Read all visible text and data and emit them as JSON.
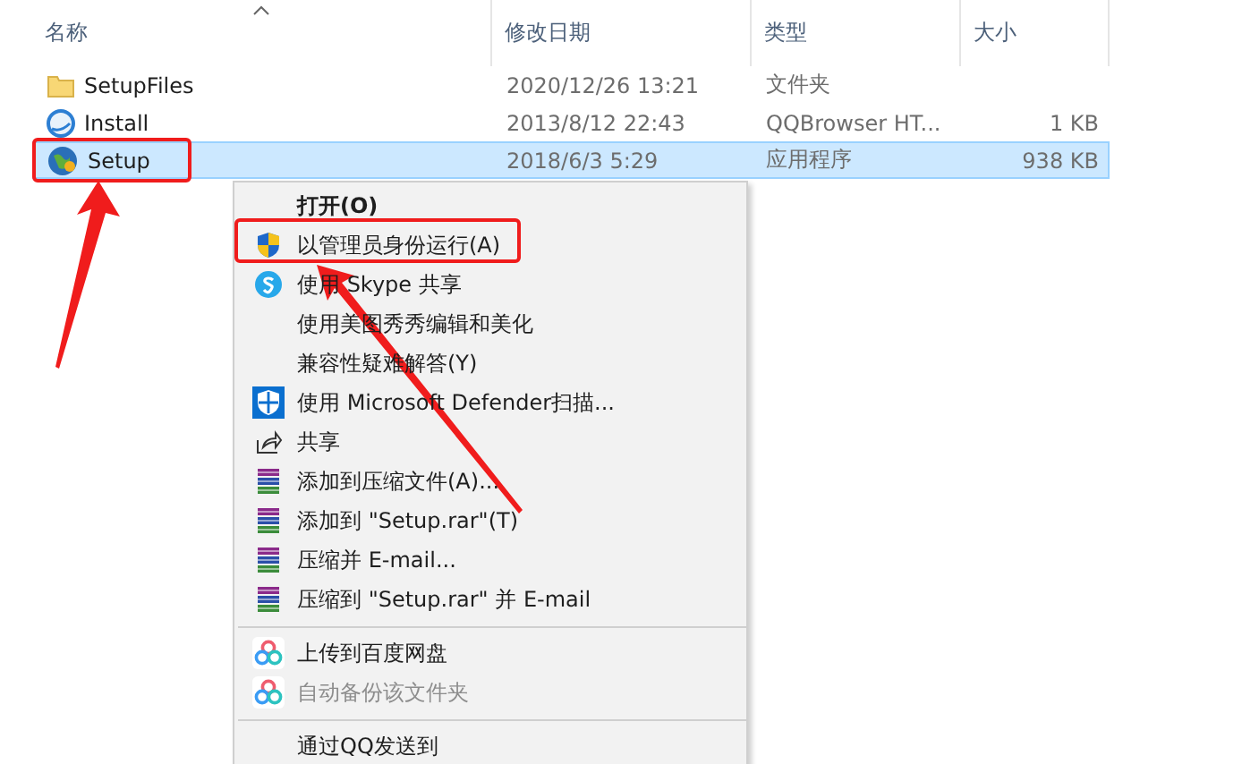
{
  "columns": [
    {
      "label": "名称",
      "sorted": true
    },
    {
      "label": "修改日期",
      "sorted": false
    },
    {
      "label": "类型",
      "sorted": false
    },
    {
      "label": "大小",
      "sorted": false
    }
  ],
  "files": [
    {
      "kind": "folder",
      "name": "SetupFiles",
      "date": "2020/12/26 13:21",
      "type": "文件夹",
      "selected": false
    },
    {
      "kind": "browser",
      "name": "Install",
      "date": "2013/8/12 22:43",
      "type": "QQBrowser HT...",
      "size": "1 KB",
      "selected": false
    },
    {
      "kind": "app",
      "name": "Setup",
      "date": "2018/6/3 5:29",
      "type": "应用程序",
      "size": "938 KB",
      "selected": true
    }
  ],
  "menu": [
    {
      "kind": "plain",
      "label": "打开(O)",
      "bold": true,
      "disabled": false
    },
    {
      "kind": "shield",
      "label": "以管理员身份运行(A)",
      "bold": false,
      "disabled": false
    },
    {
      "kind": "skype",
      "label": "使用 Skype 共享",
      "bold": false,
      "disabled": false
    },
    {
      "kind": "plain",
      "label": "使用美图秀秀编辑和美化",
      "bold": false,
      "disabled": false
    },
    {
      "kind": "plain",
      "label": "兼容性疑难解答(Y)",
      "bold": false,
      "disabled": false
    },
    {
      "kind": "defender",
      "label": "使用 Microsoft Defender扫描...",
      "bold": false,
      "disabled": false
    },
    {
      "kind": "share",
      "label": "共享",
      "bold": false,
      "disabled": false
    },
    {
      "kind": "archive",
      "label": "添加到压缩文件(A)...",
      "bold": false,
      "disabled": false
    },
    {
      "kind": "archive",
      "label": "添加到 \"Setup.rar\"(T)",
      "bold": false,
      "disabled": false
    },
    {
      "kind": "archive",
      "label": "压缩并 E-mail...",
      "bold": false,
      "disabled": false
    },
    {
      "kind": "archive",
      "label": "压缩到 \"Setup.rar\" 并 E-mail",
      "bold": false,
      "disabled": false
    },
    {
      "kind": "separator"
    },
    {
      "kind": "cloud",
      "label": "上传到百度网盘",
      "bold": false,
      "disabled": false
    },
    {
      "kind": "cloud",
      "label": "自动备份该文件夹",
      "bold": false,
      "disabled": true
    },
    {
      "kind": "separator"
    },
    {
      "kind": "plain",
      "label": "通过QQ发送到",
      "bold": false,
      "disabled": false
    }
  ]
}
